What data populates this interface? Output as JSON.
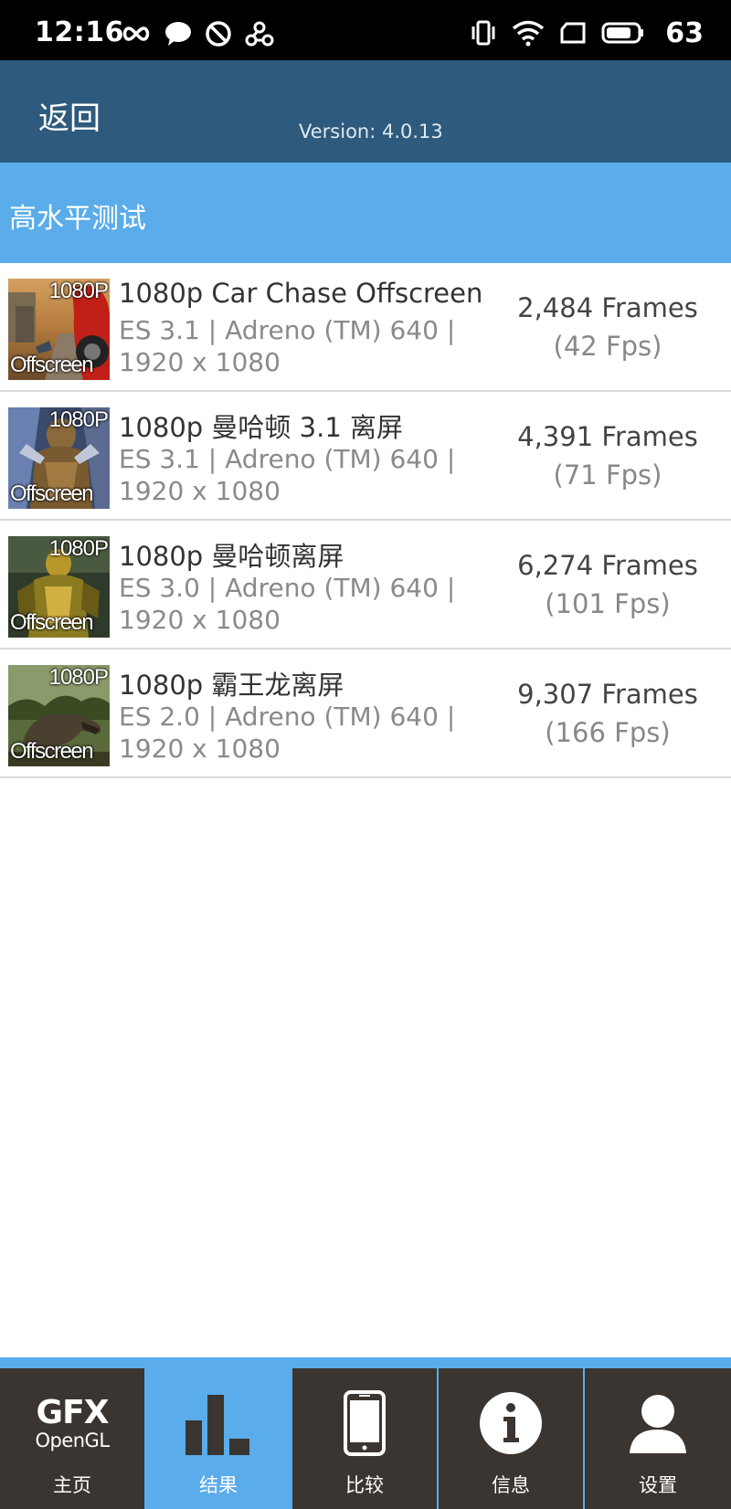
{
  "status_bar": {
    "time": "12:16",
    "battery_level": "63"
  },
  "header": {
    "back_label": "返回",
    "version": "Version: 4.0.13"
  },
  "section": {
    "title": "高水平测试"
  },
  "results": [
    {
      "thumb_top": "1080P",
      "thumb_bottom": "Offscreen",
      "name": "1080p Car Chase Offscreen",
      "detail": "ES 3.1 | Adreno (TM) 640 | 1920 x 1080",
      "frames": "2,484 Frames",
      "fps": "(42 Fps)"
    },
    {
      "thumb_top": "1080P",
      "thumb_bottom": "Offscreen",
      "name": "1080p 曼哈顿 3.1 离屏",
      "detail": "ES 3.1 | Adreno (TM) 640 | 1920 x 1080",
      "frames": "4,391 Frames",
      "fps": "(71 Fps)"
    },
    {
      "thumb_top": "1080P",
      "thumb_bottom": "Offscreen",
      "name": "1080p 曼哈顿离屏",
      "detail": "ES 3.0 | Adreno (TM) 640 | 1920 x 1080",
      "frames": "6,274 Frames",
      "fps": "(101 Fps)"
    },
    {
      "thumb_top": "1080P",
      "thumb_bottom": "Offscreen",
      "name": "1080p 霸王龙离屏",
      "detail": "ES 2.0 | Adreno (TM) 640 | 1920 x 1080",
      "frames": "9,307 Frames",
      "fps": "(166 Fps)"
    }
  ],
  "bottom_nav": {
    "logo_line1": "GFX",
    "logo_line2": "OpenGL",
    "tabs": [
      {
        "label": "主页",
        "icon": "gfx-logo-icon"
      },
      {
        "label": "结果",
        "icon": "bar-chart-icon",
        "active": true
      },
      {
        "label": "比较",
        "icon": "phone-icon"
      },
      {
        "label": "信息",
        "icon": "info-icon"
      },
      {
        "label": "设置",
        "icon": "user-icon"
      }
    ]
  },
  "colors": {
    "status_bar": "#000000",
    "app_bar": "#2d5a7d",
    "section_header": "#5aacea",
    "nav_bg": "#3a3530",
    "nav_active": "#5aacea"
  }
}
